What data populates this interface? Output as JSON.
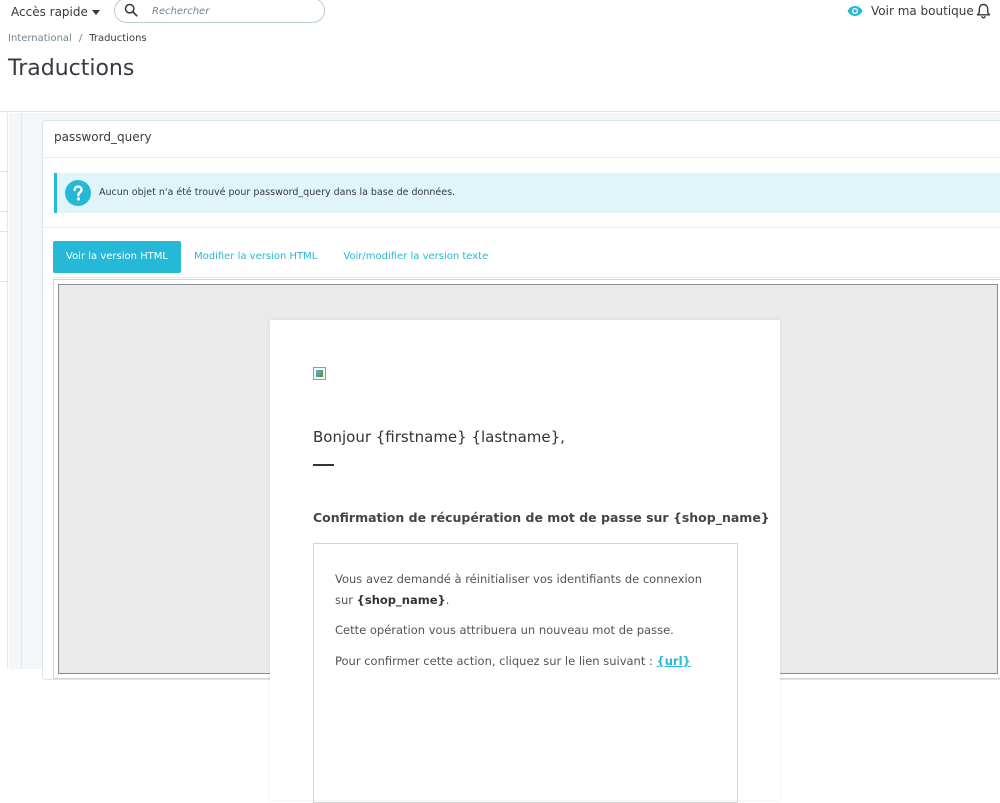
{
  "header": {
    "quick_access_label": "Accès rapide",
    "search_placeholder": "Rechercher",
    "view_shop_label": "Voir ma boutique"
  },
  "breadcrumb": {
    "parent": "International",
    "separator": "/",
    "current": "Traductions"
  },
  "page": {
    "title": "Traductions"
  },
  "panel": {
    "heading": "password_query",
    "alert_text": "Aucun objet n'a été trouvé pour password_query dans la base de données."
  },
  "tabs": [
    {
      "label": "Voir la version HTML",
      "active": true
    },
    {
      "label": "Modifier la version HTML",
      "active": false
    },
    {
      "label": "Voir/modifier la version texte",
      "active": false
    }
  ],
  "email": {
    "greeting": "Bonjour {firstname} {lastname},",
    "subtitle": "Confirmation de récupération de mot de passe sur {shop_name}",
    "p1_text": "Vous avez demandé à réinitialiser vos identifiants de connexion sur ",
    "p1_bold": "{shop_name}",
    "p1_end": ".",
    "p2": "Cette opération vous attribuera un nouveau mot de passe.",
    "p3_text": "Pour confirmer cette action, cliquez sur le lien suivant : ",
    "p3_link": "{url}"
  },
  "colors": {
    "accent": "#25b9d7",
    "alert_bg": "#dff5f9",
    "text": "#363a41"
  },
  "icons": {
    "search": "search-icon",
    "eye": "eye-icon",
    "bell": "bell-icon",
    "info": "question-circle-icon",
    "caret": "caret-down-icon"
  }
}
